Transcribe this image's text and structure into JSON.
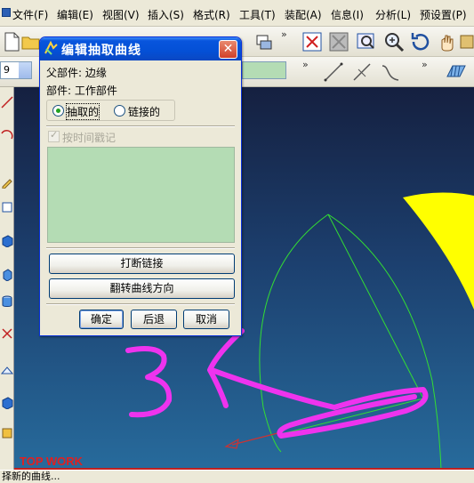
{
  "menubar": {
    "items": [
      "文件(F)",
      "编辑(E)",
      "视图(V)",
      "插入(S)",
      "格式(R)",
      "工具(T)",
      "装配(A)",
      "信息(I)",
      "分析(L)",
      "预设置(P)"
    ]
  },
  "toolbar": {
    "left_combo_value": "9",
    "overflow_label": "»"
  },
  "dialog": {
    "title": "编辑抽取曲线",
    "close_label": "✕",
    "parent_part": "父部件: 边缘",
    "part": "部件: 工作部件",
    "radio_extracted": "抽取的",
    "radio_linked": "链接的",
    "checkbox_timestamp": "按时间戳记",
    "btn_break_link": "打断链接",
    "btn_reverse_curve": "翻转曲线方向",
    "btn_ok": "确定",
    "btn_back": "后退",
    "btn_cancel": "取消"
  },
  "viewport": {
    "view_label": "TOP WORK",
    "annotation_text": "3",
    "colors": {
      "curve": "#33dd33",
      "surface": "#ffff00",
      "annotation": "#ee33ee"
    }
  },
  "statusbar": {
    "text": "择新的曲线..."
  },
  "icons": [
    "new-file-icon",
    "open-folder-icon",
    "fit-view-icon",
    "zoom-icon",
    "rotate-icon",
    "line-icon",
    "arc-icon",
    "spline-icon"
  ]
}
